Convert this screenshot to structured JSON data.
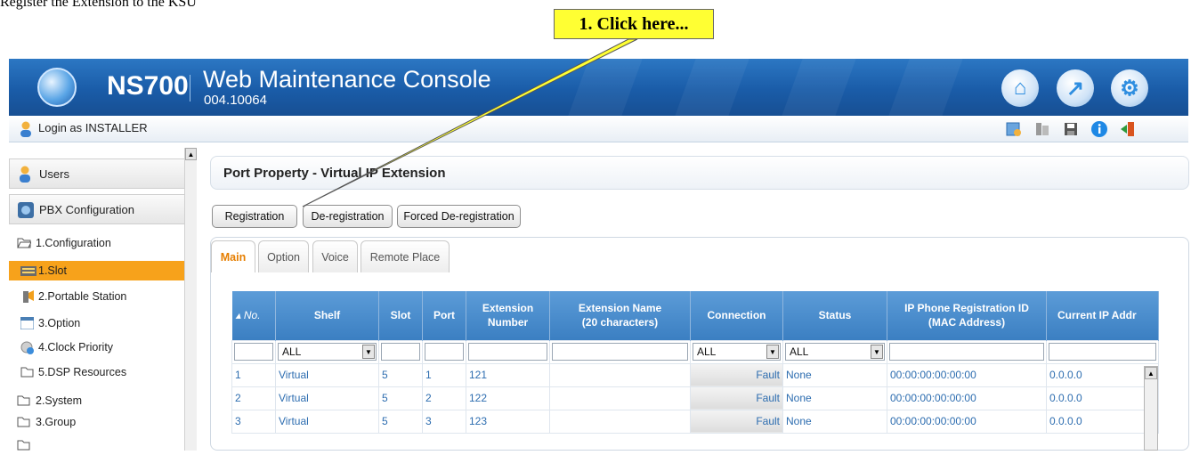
{
  "doc_title": "Register the Extension to the KSU",
  "callout": "1. Click here...",
  "header": {
    "brand": "NS700",
    "title": "Web Maintenance Console",
    "version": "004.10064"
  },
  "login": {
    "text": "Login as INSTALLER"
  },
  "sidebar": {
    "users": "Users",
    "pbx": "PBX Configuration",
    "items": [
      {
        "label": "1.Configuration"
      },
      {
        "label": "1.Slot"
      },
      {
        "label": "2.Portable Station"
      },
      {
        "label": "3.Option"
      },
      {
        "label": "4.Clock Priority"
      },
      {
        "label": "5.DSP Resources"
      },
      {
        "label": "2.System"
      },
      {
        "label": "3.Group"
      }
    ]
  },
  "main": {
    "title": "Port Property - Virtual IP Extension",
    "buttons": {
      "registration": "Registration",
      "deregistration": "De-registration",
      "forced": "Forced De-registration"
    },
    "tabs": [
      "Main",
      "Option",
      "Voice",
      "Remote Place"
    ]
  },
  "table": {
    "columns": {
      "no": "No.",
      "shelf": "Shelf",
      "slot": "Slot",
      "port": "Port",
      "ext_num_1": "Extension",
      "ext_num_2": "Number",
      "ext_name_1": "Extension Name",
      "ext_name_2": "(20 characters)",
      "connection": "Connection",
      "status": "Status",
      "mac_1": "IP Phone Registration ID",
      "mac_2": "(MAC Address)",
      "current_ip": "Current IP Addr"
    },
    "filters": {
      "shelf": "ALL",
      "connection": "ALL",
      "status": "ALL"
    },
    "rows": [
      {
        "no": "1",
        "shelf": "Virtual",
        "slot": "5",
        "port": "1",
        "ext": "121",
        "name": "",
        "connection": "Fault",
        "status": "None",
        "mac": "00:00:00:00:00:00",
        "ip": "0.0.0.0"
      },
      {
        "no": "2",
        "shelf": "Virtual",
        "slot": "5",
        "port": "2",
        "ext": "122",
        "name": "",
        "connection": "Fault",
        "status": "None",
        "mac": "00:00:00:00:00:00",
        "ip": "0.0.0.0"
      },
      {
        "no": "3",
        "shelf": "Virtual",
        "slot": "5",
        "port": "3",
        "ext": "123",
        "name": "",
        "connection": "Fault",
        "status": "None",
        "mac": "00:00:00:00:00:00",
        "ip": "0.0.0.0"
      }
    ]
  }
}
